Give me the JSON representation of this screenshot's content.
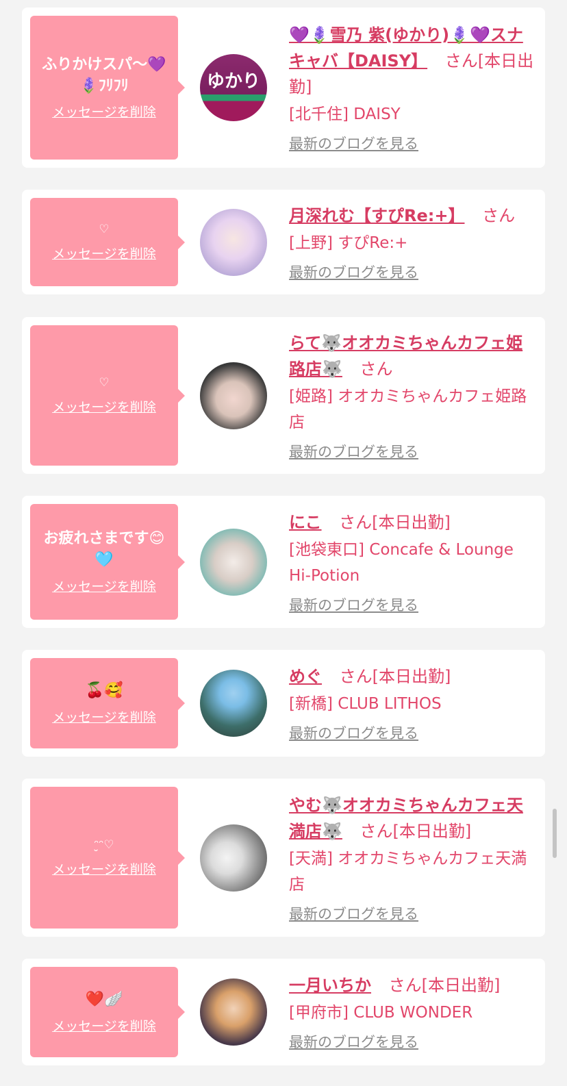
{
  "colors": {
    "bubble": "#fe9aa9",
    "accent": "#e2466a",
    "card": "#ffffff",
    "background": "#f3f3f3",
    "link_gray": "#8b8b8b"
  },
  "common": {
    "delete_label": "メッセージを削除",
    "blog_label": "最新のブログを見る",
    "san": "さん"
  },
  "cards": [
    {
      "message": "ふりかけスパ〜💜🪻ﾌﾘﾌﾘ",
      "name": "💜🪻雪乃 紫(ゆかり)🪻💜スナキャバ【DAISY】",
      "status": "[本日出勤]",
      "place": "[北千住] DAISY",
      "avatar_text": "ゆかり"
    },
    {
      "message": "♡",
      "name": "月深れむ【すぴRe:+】",
      "status": "",
      "place": "[上野] すぴRe:+"
    },
    {
      "message": "♡",
      "name": "らて🐺オオカミちゃんカフェ姫路店🐺",
      "status": "",
      "place": "[姫路] オオカミちゃんカフェ姫路店"
    },
    {
      "message": "お疲れさまです😊🩵",
      "name": "にこ",
      "status": "[本日出勤]",
      "place": "[池袋東口] Concafe & Lounge Hi-Potion"
    },
    {
      "message": "🍒🥰",
      "name": "めぐ",
      "status": "[本日出勤]",
      "place": "[新橋] CLUB LITHOS"
    },
    {
      "message": "ᵔ̮ᵔ♡",
      "name": "やむ🐺オオカミちゃんカフェ天満店🐺",
      "status": "[本日出勤]",
      "place": "[天満] オオカミちゃんカフェ天満店"
    },
    {
      "message": "❤️🪽",
      "name": "一月いちか",
      "status": "[本日出勤]",
      "place": "[甲府市] CLUB WONDER"
    }
  ]
}
